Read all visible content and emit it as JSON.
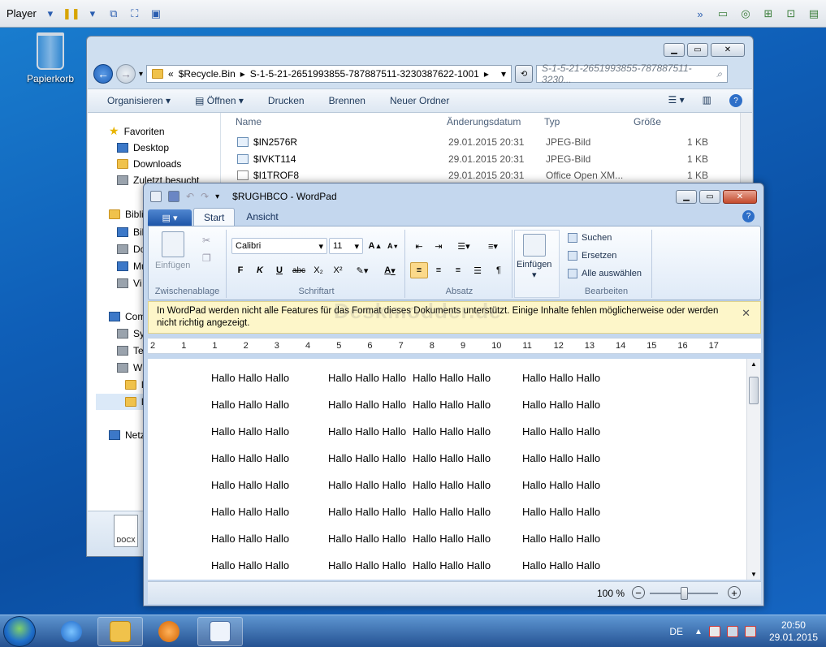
{
  "player": {
    "label": "Player"
  },
  "desktop": {
    "recycle_bin": "Papierkorb"
  },
  "explorer": {
    "address": {
      "chevrons": "«",
      "segment1": "$Recycle.Bin",
      "segment2": "S-1-5-21-2651993855-787887511-3230387622-1001"
    },
    "search_placeholder": "S-1-5-21-2651993855-787887511-3230...",
    "commands": {
      "organize": "Organisieren",
      "open": "Öffnen",
      "print": "Drucken",
      "burn": "Brennen",
      "new_folder": "Neuer Ordner"
    },
    "nav": {
      "favorites": "Favoriten",
      "desktop": "Desktop",
      "downloads": "Downloads",
      "recent": "Zuletzt besucht",
      "libraries": "Bibli",
      "lib1": "Bil",
      "lib2": "Do",
      "lib3": "Mu",
      "lib4": "Vi",
      "computer": "Com",
      "c1": "Sy",
      "c2": "Te",
      "c3": "W",
      "c4": "l",
      "c5": "l",
      "network": "Netz"
    },
    "columns": {
      "name": "Name",
      "date": "Änderungsdatum",
      "type": "Typ",
      "size": "Größe"
    },
    "files": [
      {
        "name": "$IN2576R",
        "date": "29.01.2015 20:31",
        "type": "JPEG-Bild",
        "size": "1 KB"
      },
      {
        "name": "$IVKT114",
        "date": "29.01.2015 20:31",
        "type": "JPEG-Bild",
        "size": "1 KB"
      },
      {
        "name": "$I1TROF8",
        "date": "29.01.2015 20:31",
        "type": "Office Open XM...",
        "size": "1 KB"
      }
    ],
    "details_icon_label": "DOCX"
  },
  "wordpad": {
    "title": "$RUGHBCO - WordPad",
    "tabs": {
      "start": "Start",
      "view": "Ansicht"
    },
    "ribbon": {
      "paste": "Einfügen",
      "clipboard": "Zwischenablage",
      "font_name": "Calibri",
      "font_size": "11",
      "font_group": "Schriftart",
      "bold": "F",
      "italic": "K",
      "underline": "U",
      "strike": "abc",
      "sub": "X₂",
      "sup": "X²",
      "paragraph": "Absatz",
      "insert": "Einfügen",
      "find": "Suchen",
      "replace": "Ersetzen",
      "select_all": "Alle auswählen",
      "editing": "Bearbeiten"
    },
    "infobar": "In WordPad werden nicht alle Features für das Format dieses Dokuments unterstützt. Einige Inhalte fehlen möglicherweise oder werden nicht richtig angezeigt.",
    "watermark": "Deskmodder.de",
    "ruler": [
      "2",
      "1",
      "1",
      "2",
      "3",
      "4",
      "5",
      "6",
      "7",
      "8",
      "9",
      "10",
      "11",
      "12",
      "13",
      "14",
      "15",
      "16",
      "17"
    ],
    "doc": {
      "c1": "Hallo Hallo Hallo",
      "c2": "Hallo Hallo Hallo",
      "c3": "Hallo Hallo Hallo",
      "c4": "Hallo Hallo Hallo",
      "rows": 8
    },
    "zoom": "100 %"
  },
  "taskbar": {
    "lang": "DE",
    "time": "20:50",
    "date": "29.01.2015"
  }
}
